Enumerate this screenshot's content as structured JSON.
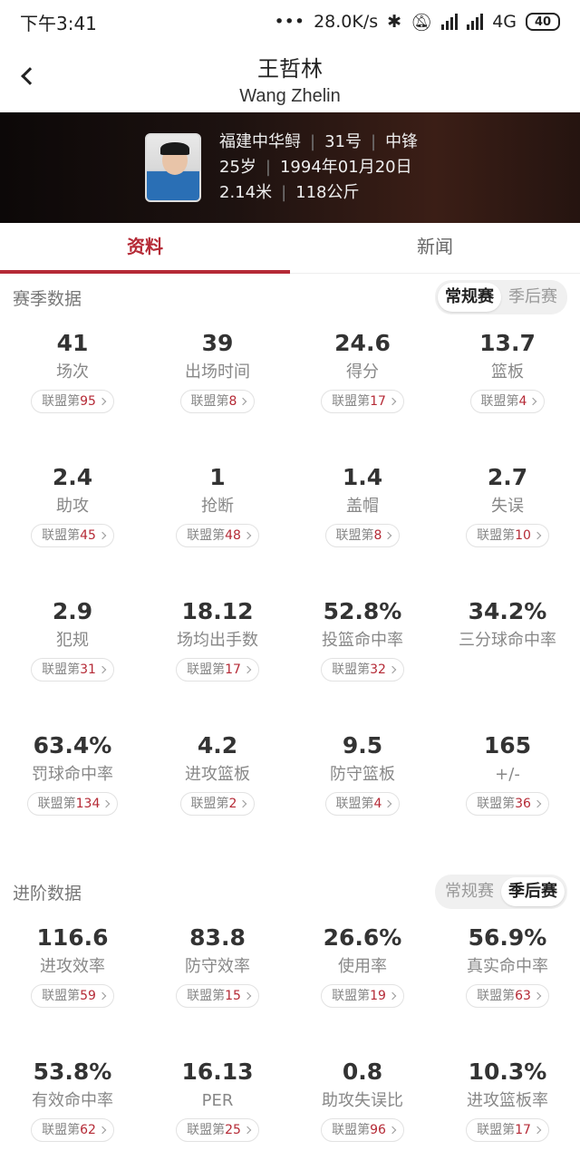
{
  "status_bar": {
    "time": "下午3:41",
    "speed": "28.0K/s",
    "network": "4G",
    "battery": "40"
  },
  "header": {
    "name_cn": "王哲林",
    "name_en": "Wang Zhelin"
  },
  "profile": {
    "team": "福建中华鲟",
    "number": "31号",
    "position": "中锋",
    "age": "25岁",
    "birthday": "1994年01月20日",
    "height": "2.14米",
    "weight": "118公斤"
  },
  "tabs": [
    {
      "label": "资料",
      "active": true
    },
    {
      "label": "新闻",
      "active": false
    }
  ],
  "season_stats": {
    "title": "赛季数据",
    "toggle": [
      {
        "label": "常规赛",
        "selected": true
      },
      {
        "label": "季后赛",
        "selected": false
      }
    ],
    "rank_prefix": "联盟第",
    "items": [
      {
        "value": "41",
        "label": "场次",
        "rank": "95"
      },
      {
        "value": "39",
        "label": "出场时间",
        "rank": "8"
      },
      {
        "value": "24.6",
        "label": "得分",
        "rank": "17"
      },
      {
        "value": "13.7",
        "label": "篮板",
        "rank": "4"
      },
      {
        "value": "2.4",
        "label": "助攻",
        "rank": "45"
      },
      {
        "value": "1",
        "label": "抢断",
        "rank": "48"
      },
      {
        "value": "1.4",
        "label": "盖帽",
        "rank": "8"
      },
      {
        "value": "2.7",
        "label": "失误",
        "rank": "10"
      },
      {
        "value": "2.9",
        "label": "犯规",
        "rank": "31"
      },
      {
        "value": "18.12",
        "label": "场均出手数",
        "rank": "17"
      },
      {
        "value": "52.8%",
        "label": "投篮命中率",
        "rank": "32"
      },
      {
        "value": "34.2%",
        "label": "三分球命中率",
        "rank": ""
      },
      {
        "value": "63.4%",
        "label": "罚球命中率",
        "rank": "134"
      },
      {
        "value": "4.2",
        "label": "进攻篮板",
        "rank": "2"
      },
      {
        "value": "9.5",
        "label": "防守篮板",
        "rank": "4"
      },
      {
        "value": "165",
        "label": "+/-",
        "rank": "36"
      }
    ]
  },
  "advanced_stats": {
    "title": "进阶数据",
    "toggle": [
      {
        "label": "常规赛",
        "selected": false
      },
      {
        "label": "季后赛",
        "selected": true
      }
    ],
    "rank_prefix": "联盟第",
    "items": [
      {
        "value": "116.6",
        "label": "进攻效率",
        "rank": "59"
      },
      {
        "value": "83.8",
        "label": "防守效率",
        "rank": "15"
      },
      {
        "value": "26.6%",
        "label": "使用率",
        "rank": "19"
      },
      {
        "value": "56.9%",
        "label": "真实命中率",
        "rank": "63"
      },
      {
        "value": "53.8%",
        "label": "有效命中率",
        "rank": "62"
      },
      {
        "value": "16.13",
        "label": "PER",
        "rank": "25"
      },
      {
        "value": "0.8",
        "label": "助攻失误比",
        "rank": "96"
      },
      {
        "value": "10.3%",
        "label": "进攻篮板率",
        "rank": "17"
      }
    ]
  }
}
